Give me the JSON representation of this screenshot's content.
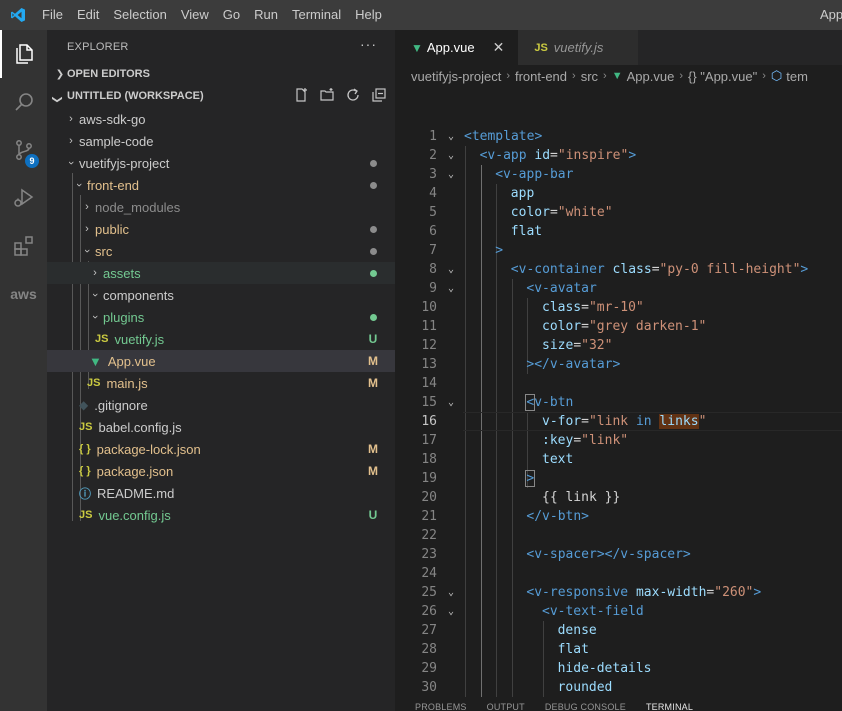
{
  "titlebar": {
    "menu": [
      "File",
      "Edit",
      "Selection",
      "View",
      "Go",
      "Run",
      "Terminal",
      "Help"
    ],
    "window_title": "App"
  },
  "activity": {
    "scm_badge": "9",
    "aws_label": "aws"
  },
  "sidebar": {
    "header": "EXPLORER",
    "more": "···",
    "open_editors": "OPEN EDITORS",
    "workspace": "UNTITLED (WORKSPACE)",
    "tree": [
      {
        "label": "aws-sdk-go",
        "decoration": "",
        "color": "#cccccc"
      },
      {
        "label": "sample-code",
        "decoration": "",
        "color": "#cccccc"
      },
      {
        "label": "vuetifyjs-project",
        "decoration": "",
        "color": "#cccccc"
      },
      {
        "label": "front-end",
        "decoration": "",
        "color": "#e2c08d"
      },
      {
        "label": "node_modules",
        "decoration": "",
        "color": "#8c8c8c"
      },
      {
        "label": "public",
        "decoration": "",
        "color": "#e2c08d"
      },
      {
        "label": "src",
        "decoration": "",
        "color": "#e2c08d"
      },
      {
        "label": "assets",
        "decoration": "",
        "color": "#73c991"
      },
      {
        "label": "components",
        "decoration": "",
        "color": "#cccccc"
      },
      {
        "label": "plugins",
        "decoration": "",
        "color": "#73c991"
      },
      {
        "label": "vuetify.js",
        "decoration": "U",
        "color": "#73c991"
      },
      {
        "label": "App.vue",
        "decoration": "M",
        "color": "#e2c08d"
      },
      {
        "label": "main.js",
        "decoration": "M",
        "color": "#e2c08d"
      },
      {
        "label": ".gitignore",
        "decoration": "",
        "color": "#cccccc"
      },
      {
        "label": "babel.config.js",
        "decoration": "",
        "color": "#cccccc"
      },
      {
        "label": "package-lock.json",
        "decoration": "M",
        "color": "#e2c08d"
      },
      {
        "label": "package.json",
        "decoration": "M",
        "color": "#e2c08d"
      },
      {
        "label": "README.md",
        "decoration": "",
        "color": "#cccccc"
      },
      {
        "label": "vue.config.js",
        "decoration": "U",
        "color": "#73c991"
      }
    ]
  },
  "editor": {
    "tabs": [
      {
        "label": "App.vue",
        "close": "✕"
      },
      {
        "label": "vuetify.js"
      }
    ],
    "breadcrumb": [
      "vuetifyjs-project",
      "front-end",
      "src",
      "App.vue",
      "{} \"App.vue\"",
      "tem"
    ],
    "panel_tabs": [
      "PROBLEMS",
      "OUTPUT",
      "DEBUG CONSOLE",
      "TERMINAL"
    ]
  },
  "colors": {
    "accent": "#007acc",
    "modified": "#e2c08d",
    "untracked": "#73c991",
    "vue_green": "#41b883",
    "js_yellow": "#cbcb41"
  }
}
